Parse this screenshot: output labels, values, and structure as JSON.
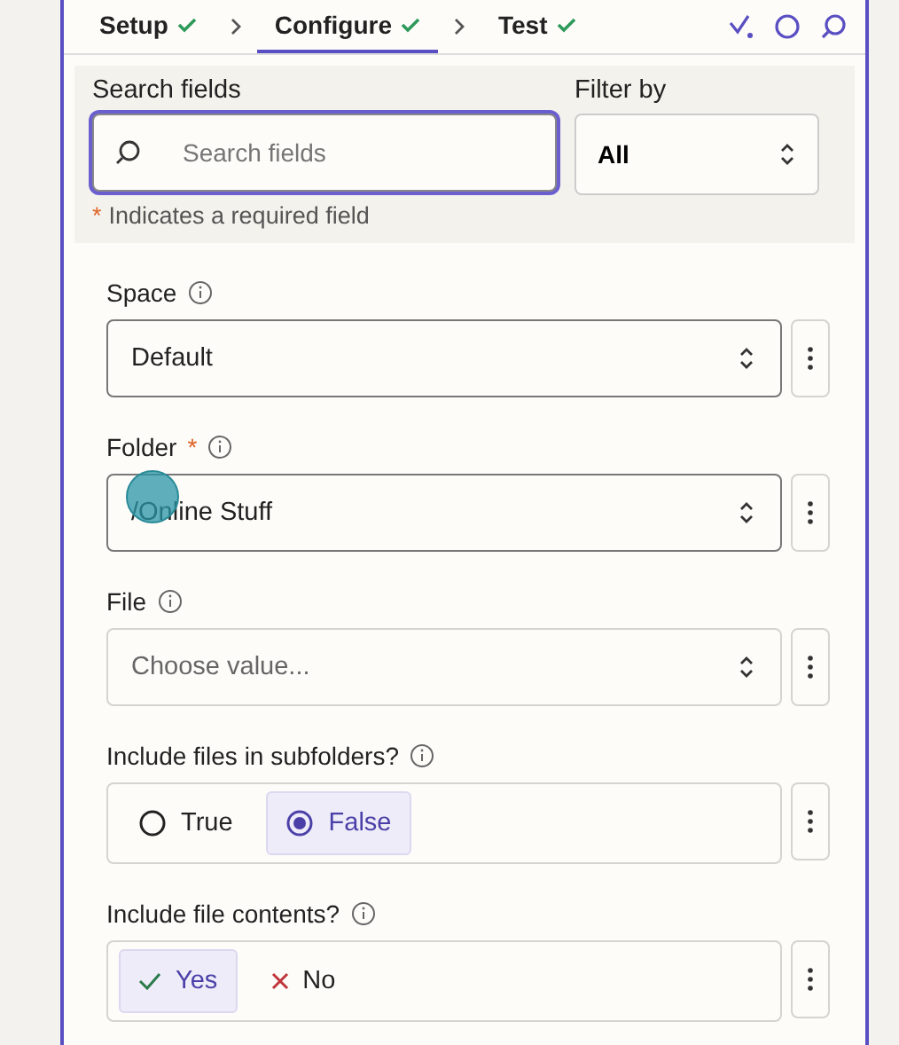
{
  "tabs": [
    {
      "label": "Setup",
      "done": true,
      "selected": false
    },
    {
      "label": "Configure",
      "done": true,
      "selected": true
    },
    {
      "label": "Test",
      "done": true,
      "selected": false
    }
  ],
  "search": {
    "label": "Search fields",
    "placeholder": "Search fields",
    "focused": true
  },
  "filter": {
    "label": "Filter by",
    "value": "All"
  },
  "required_mark": "*",
  "required_note": "Indicates a required field",
  "fields": [
    {
      "kind": "select",
      "label": "Space",
      "required": false,
      "value": "Default"
    },
    {
      "kind": "select",
      "label": "Folder",
      "required": true,
      "value": "/Online Stuff"
    },
    {
      "kind": "select",
      "label": "File",
      "required": false,
      "placeholder": "Choose value..."
    },
    {
      "kind": "radio",
      "label": "Include files in subfolders?",
      "required": false,
      "options": [
        {
          "label": "True",
          "selected": false
        },
        {
          "label": "False",
          "selected": true
        }
      ]
    },
    {
      "kind": "toggle",
      "label": "Include file contents?",
      "required": false,
      "options": [
        {
          "label": "Yes",
          "selected": true
        },
        {
          "label": "No",
          "selected": false
        }
      ]
    }
  ]
}
